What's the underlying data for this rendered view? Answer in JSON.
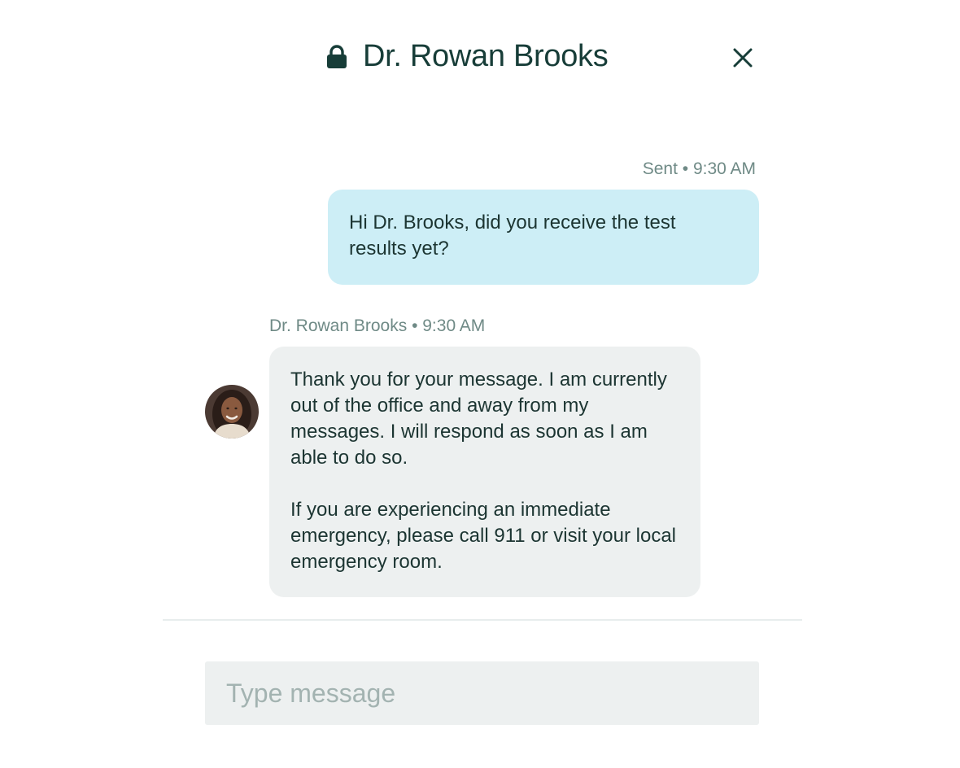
{
  "header": {
    "title": "Dr. Rowan Brooks",
    "lock_icon": "lock-icon",
    "close_icon": "close-icon"
  },
  "messages": [
    {
      "direction": "sent",
      "meta": "Sent • 9:30 AM",
      "text": "Hi Dr. Brooks, did you receive the test results yet?"
    },
    {
      "direction": "received",
      "meta": "Dr. Rowan Brooks • 9:30 AM",
      "paragraphs": [
        "Thank you for your message. I am currently out of the office and away from my messages. I will respond as soon as I am able to do so.",
        "If you are experiencing an immediate emergency, please call 911 or visit your local emergency room."
      ]
    }
  ],
  "composer": {
    "placeholder": "Type message",
    "value": ""
  },
  "colors": {
    "title": "#173d38",
    "sent_bubble": "#cdeef6",
    "received_bubble": "#edf0f0",
    "meta_text": "#6f8a86",
    "placeholder": "#a3b3b1"
  }
}
